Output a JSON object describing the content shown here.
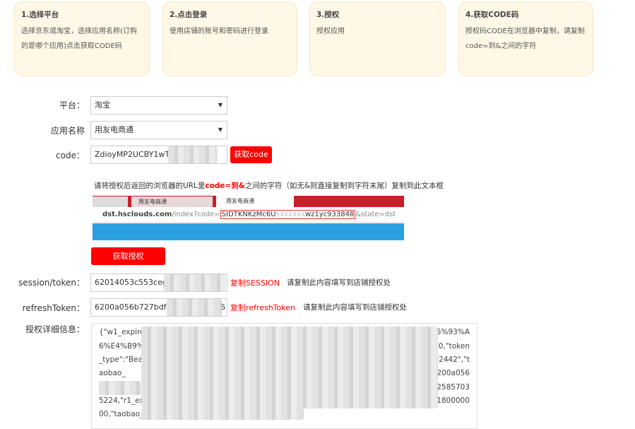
{
  "steps": [
    {
      "title": "1.选择平台",
      "desc": "选择京东或淘宝，选择应用名称(订购的是哪个应用)点击获取CODE码"
    },
    {
      "title": "2.点击登录",
      "desc": "使用店铺的账号和密码进行登录"
    },
    {
      "title": "3.授权",
      "desc": "授权应用"
    },
    {
      "title": "4.获取CODE码",
      "desc": "授权码CODE在浏览器中复制，请复制code=到&之间的字符"
    }
  ],
  "form": {
    "platform_label": "平台：",
    "platform_value": "淘宝",
    "app_label": "应用名称",
    "app_value": "用友电商通",
    "code_label": "code：",
    "code_value": "ZdioyMP2UCBY1wTir",
    "get_code_button": "获取code",
    "instruction_pre": "请将授权后返回的浏览器的URL里",
    "instruction_red": "code=到&",
    "instruction_post": "之间的字符（如无&则直接复制到字符末尾）复制到此文本框",
    "authorize_button": "获取授权",
    "session_label": "session/token：",
    "session_value": "62014053c553ceg0",
    "copy_session": "复制SESSION",
    "session_note": "请复制此内容填写到店铺授权处",
    "refresh_label": "refreshToken：",
    "refresh_value": "6200a056b727bdf5e",
    "refresh_value_end": "6",
    "copy_refresh": "复制refreshToken",
    "refresh_note": "请复制此内容填写到店铺授权处",
    "detail_label": "授权详细信息：",
    "detail_lines": [
      {
        "start": "{\"w1_expire",
        "end": "E5%93%A"
      },
      {
        "start": "6%E4%B9%",
        "end": "000,\"token"
      },
      {
        "start": "_type\":\"Bea",
        "end": "452442\",\"t"
      },
      {
        "start": "aobao_",
        "end": "\"6200a056"
      },
      {
        "start": "",
        "end": "152585703"
      },
      {
        "start": "5224,\"r1_ex",
        "end": "571800000"
      },
      {
        "start": "00,\"taobao_u",
        "end": ""
      }
    ]
  },
  "screenshot": {
    "tab1": "用友电商通",
    "tab2": "用友电商通",
    "url_host": "dst.hsclouds.com",
    "url_path": "/index?code=",
    "url_code": "SIDTKNKzMc6U",
    "url_code_end": "wz1yc933848",
    "url_tail": "&state=dst"
  }
}
